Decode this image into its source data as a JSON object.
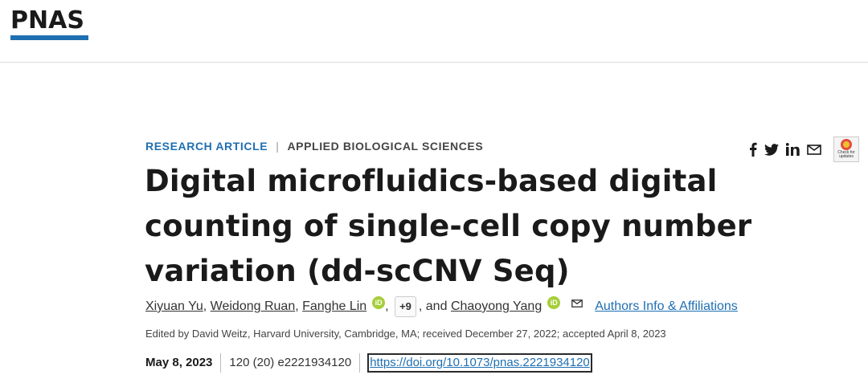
{
  "header": {
    "logo": "PNAS"
  },
  "article_meta": {
    "type": "RESEARCH ARTICLE",
    "separator": "|",
    "subject": "APPLIED BIOLOGICAL SCIENCES"
  },
  "share": {
    "icons": [
      "facebook-icon",
      "twitter-icon",
      "linkedin-icon",
      "email-icon"
    ],
    "crossmark": "Check for updates"
  },
  "title": "Digital microfluidics-based digital counting of single-cell copy number variation (dd-scCNV Seq)",
  "authors": {
    "list": [
      "Xiyuan Yu",
      "Weidong Ruan",
      "Fanghe Lin"
    ],
    "more": "+9",
    "and": ", and",
    "last": "Chaoyong Yang",
    "affiliations_link": "Authors Info & Affiliations"
  },
  "edited": "Edited by David Weitz, Harvard University, Cambridge, MA; received December 27, 2022; accepted April 8, 2023",
  "pub": {
    "date": "May 8, 2023",
    "volume": "120 (20) e2221934120",
    "doi": "https://doi.org/10.1073/pnas.2221934120"
  },
  "colors": {
    "accent": "#1f6fb2",
    "orcid": "#a6ce39"
  }
}
